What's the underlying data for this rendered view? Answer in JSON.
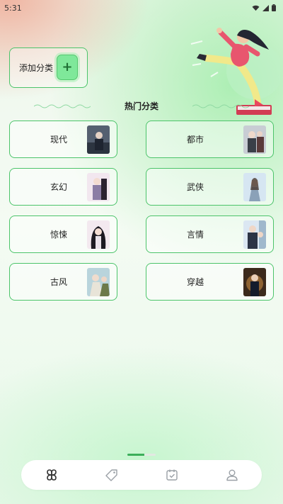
{
  "status_bar": {
    "time": "5:31",
    "icons": [
      "wifi-icon",
      "signal-icon",
      "battery-icon"
    ]
  },
  "add_category": {
    "label": "添加分类",
    "button_symbol": "+"
  },
  "section": {
    "title": "热门分类"
  },
  "categories": [
    {
      "label": "现代",
      "cover_colors": [
        "#556070",
        "#2c3440"
      ]
    },
    {
      "label": "都市",
      "cover_colors": [
        "#c8cdd4",
        "#3a3f48"
      ]
    },
    {
      "label": "玄幻",
      "cover_colors": [
        "#f2e7ef",
        "#8b7da5"
      ]
    },
    {
      "label": "武侠",
      "cover_colors": [
        "#d6e6f2",
        "#8aa1b8"
      ]
    },
    {
      "label": "惊悚",
      "cover_colors": [
        "#f3e9ef",
        "#1d1a22"
      ]
    },
    {
      "label": "言情",
      "cover_colors": [
        "#dbe7f2",
        "#2c3445"
      ]
    },
    {
      "label": "古风",
      "cover_colors": [
        "#b9d4dc",
        "#6c7a4a"
      ]
    },
    {
      "label": "穿越",
      "cover_colors": [
        "#3c2a1c",
        "#c58b42"
      ]
    }
  ],
  "colors": {
    "accent": "#4cc46a",
    "accent_light": "#7fe89a",
    "tab_icon": "#9aa0a6",
    "tab_active": "#333333"
  },
  "tabs": [
    {
      "icon": "category-clover-icon",
      "active": true
    },
    {
      "icon": "tag-icon",
      "active": false
    },
    {
      "icon": "calendar-check-icon",
      "active": false
    },
    {
      "icon": "person-icon",
      "active": false
    }
  ],
  "page_indicator": {
    "progress": 0.6
  }
}
